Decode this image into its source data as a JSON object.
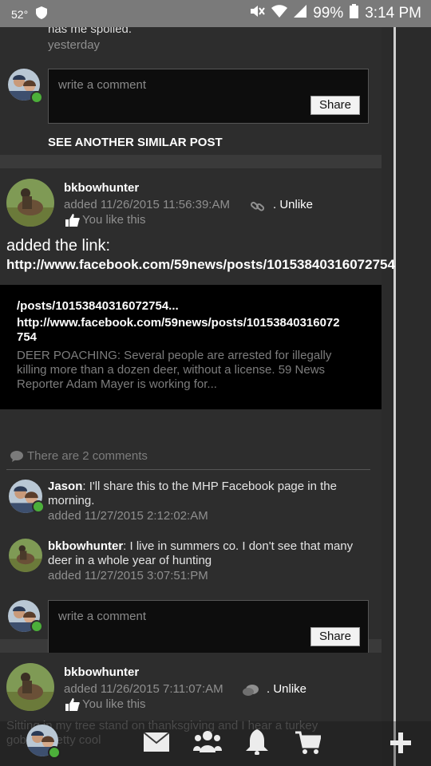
{
  "status": {
    "temp": "52°",
    "battery": "99%",
    "time": "3:14 PM"
  },
  "top_card": {
    "partial_text": "has me spoiled.",
    "when": "yesterday",
    "comment_placeholder": "write a comment",
    "share": "Share",
    "similar_link": "SEE ANOTHER SIMILAR POST"
  },
  "post1": {
    "author": "bkbowhunter",
    "added": "added 11/26/2015 11:56:39:AM",
    "unlike": ". Unlike",
    "you_like": "You like this",
    "body_line1": "added the link:",
    "body_url": "http://www.facebook.com/59news/posts/10153840316072754",
    "preview": {
      "title": "/posts/10153840316072754...",
      "url": "http://www.facebook.com/59news/posts/10153840316072\n754",
      "desc": "DEER POACHING: Several people are arrested for illegally killing more than a dozen deer, without a license. 59 News Reporter Adam Mayer is working for..."
    },
    "comment_count": "There are 2 comments",
    "comments": [
      {
        "name": "Jason",
        "text": ": I'll share this to the MHP Facebook page in the morning.",
        "when": "added 11/27/2015 2:12:02:AM"
      },
      {
        "name": "bkbowhunter",
        "text": ": I live in summers co. I don't see that many deer in a whole year of hunting",
        "when": "added 11/27/2015 3:07:51:PM"
      }
    ],
    "comment_placeholder": "write a comment",
    "share": "Share"
  },
  "post2": {
    "author": "bkbowhunter",
    "added": "added 11/26/2015 7:11:07:AM",
    "unlike": ". Unlike",
    "you_like": "You like this",
    "body_partial": "Sitting in my tree stand on thanksgiving and I hear a turkey gobble pretty cool"
  },
  "nav": {
    "items": [
      "mail-icon",
      "people-icon",
      "bell-icon",
      "cart-icon",
      "plus-icon"
    ]
  },
  "colors": {
    "bg": "#3a3a3a",
    "card": "#2d2d2d",
    "online": "#4caf3a"
  }
}
